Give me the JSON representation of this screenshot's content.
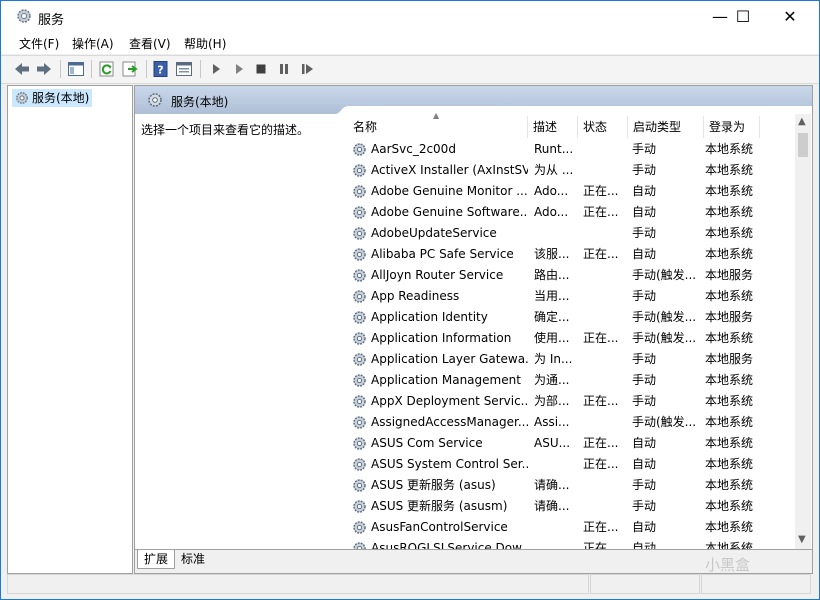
{
  "window": {
    "title": "服务",
    "icon": "gear-icon"
  },
  "window_controls": {
    "minimize": "—",
    "maximize": "☐",
    "close": "✕"
  },
  "menu": [
    "文件(F)",
    "操作(A)",
    "查看(V)",
    "帮助(H)"
  ],
  "toolbar_icons": [
    "back-arrow-icon",
    "forward-arrow-icon",
    "console-tree-icon",
    "refresh-icon",
    "export-list-icon",
    "help-icon",
    "properties-icon",
    "start-service-icon",
    "start-alt-icon",
    "stop-service-icon",
    "pause-service-icon",
    "restart-service-icon"
  ],
  "tree": {
    "item": "服务(本地)"
  },
  "pane": {
    "header": "服务(本地)",
    "description_prompt": "选择一个项目来查看它的描述。"
  },
  "columns": [
    "名称",
    "描述",
    "状态",
    "启动类型",
    "登录为"
  ],
  "services": [
    {
      "name": "AarSvc_2c00d",
      "desc": "Runt...",
      "status": "",
      "startup": "手动",
      "login": "本地系统"
    },
    {
      "name": "ActiveX Installer (AxInstSV)",
      "desc": "为从 ...",
      "status": "",
      "startup": "手动",
      "login": "本地系统"
    },
    {
      "name": "Adobe Genuine Monitor ...",
      "desc": "Ado...",
      "status": "正在...",
      "startup": "自动",
      "login": "本地系统"
    },
    {
      "name": "Adobe Genuine Software...",
      "desc": "Ado...",
      "status": "正在...",
      "startup": "自动",
      "login": "本地系统"
    },
    {
      "name": "AdobeUpdateService",
      "desc": "",
      "status": "",
      "startup": "手动",
      "login": "本地系统"
    },
    {
      "name": "Alibaba PC Safe Service",
      "desc": "该服...",
      "status": "正在...",
      "startup": "自动",
      "login": "本地系统"
    },
    {
      "name": "AllJoyn Router Service",
      "desc": "路由...",
      "status": "",
      "startup": "手动(触发...",
      "login": "本地服务"
    },
    {
      "name": "App Readiness",
      "desc": "当用...",
      "status": "",
      "startup": "手动",
      "login": "本地系统"
    },
    {
      "name": "Application Identity",
      "desc": "确定...",
      "status": "",
      "startup": "手动(触发...",
      "login": "本地服务"
    },
    {
      "name": "Application Information",
      "desc": "使用...",
      "status": "正在...",
      "startup": "手动(触发...",
      "login": "本地系统"
    },
    {
      "name": "Application Layer Gatewa...",
      "desc": "为 In...",
      "status": "",
      "startup": "手动",
      "login": "本地服务"
    },
    {
      "name": "Application Management",
      "desc": "为通...",
      "status": "",
      "startup": "手动",
      "login": "本地系统"
    },
    {
      "name": "AppX Deployment Servic...",
      "desc": "为部...",
      "status": "正在...",
      "startup": "手动",
      "login": "本地系统"
    },
    {
      "name": "AssignedAccessManager...",
      "desc": "Assi...",
      "status": "",
      "startup": "手动(触发...",
      "login": "本地系统"
    },
    {
      "name": "ASUS Com Service",
      "desc": "ASU...",
      "status": "正在...",
      "startup": "自动",
      "login": "本地系统"
    },
    {
      "name": "ASUS System Control Ser...",
      "desc": "",
      "status": "正在...",
      "startup": "自动",
      "login": "本地系统"
    },
    {
      "name": "ASUS 更新服务 (asus)",
      "desc": "请确...",
      "status": "",
      "startup": "手动",
      "login": "本地系统"
    },
    {
      "name": "ASUS 更新服务 (asusm)",
      "desc": "请确...",
      "status": "",
      "startup": "手动",
      "login": "本地系统"
    },
    {
      "name": "AsusFanControlService",
      "desc": "",
      "status": "正在...",
      "startup": "自动",
      "login": "本地系统"
    },
    {
      "name": "AsusROGLSLService Dow...",
      "desc": "",
      "status": "正在...",
      "startup": "自动",
      "login": "本地系统"
    }
  ],
  "tabs": [
    "扩展",
    "标准"
  ],
  "watermark": "小黑盒"
}
